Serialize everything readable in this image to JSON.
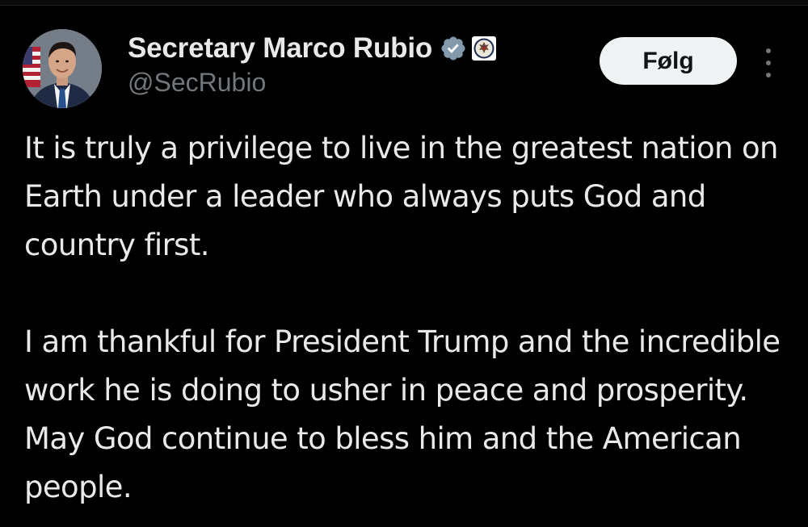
{
  "author": {
    "display_name": "Secretary Marco Rubio",
    "handle": "@SecRubio",
    "verified_icon": "verified-badge-icon",
    "affiliation_icon": "us-state-department-seal-icon",
    "avatar_icon": "profile-photo"
  },
  "actions": {
    "follow_label": "Følg",
    "more_icon": "more-options-vertical-icon"
  },
  "tweet": {
    "paragraphs": [
      "It is truly a privilege to live in the greatest nation on Earth under a leader who always puts God and country first.",
      "I am thankful for President Trump and the incredible work he is doing to usher in peace and prosperity. May God continue to bless him and the American people."
    ]
  },
  "colors": {
    "background": "#000000",
    "text_primary": "#e7e9ea",
    "text_secondary": "#71767b",
    "button_bg": "#eff3f4",
    "button_text": "#0f1419",
    "verified_gray": "#829aab"
  }
}
